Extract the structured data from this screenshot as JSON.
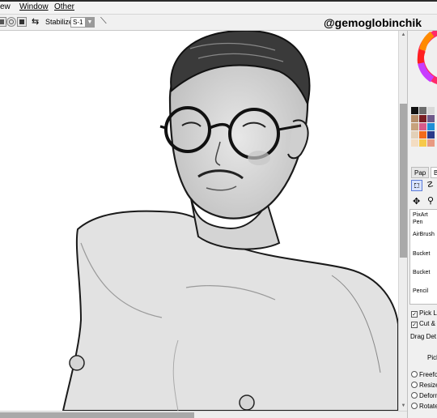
{
  "menu": {
    "items": [
      "ew",
      "Window",
      "Other"
    ]
  },
  "toolbar": {
    "stabilizer_label": "Stabilizer",
    "stabilizer_value": "S-1"
  },
  "watermark": "@gemoglobinchik",
  "palette": {
    "swatches": [
      "#111111",
      "#6c6c6c",
      "#d8d8d8",
      "#b68e6a",
      "#7a1d22",
      "#6f5a8a",
      "#c7a27c",
      "#d65a8a",
      "#1e8fd6",
      "#e2d0b8",
      "#f26a1a",
      "#2a3a8a",
      "#f3dcc2",
      "#f7c94a",
      "#e89a82"
    ]
  },
  "panel": {
    "tabs": [
      "Pap",
      "B"
    ],
    "tools": [
      {
        "line1": "PixArt",
        "line2": "Pen"
      },
      {
        "line1": "AirBrush",
        "line2": ""
      },
      {
        "line1": "Bucket",
        "line2": ""
      },
      {
        "line1": "Bucket",
        "line2": ""
      },
      {
        "line1": "Pencil",
        "line2": ""
      }
    ],
    "checkboxes": [
      {
        "label": "Pick L",
        "checked": true
      },
      {
        "label": "Cut &",
        "checked": true
      }
    ],
    "drag_label": "Drag Det",
    "pick_label": "Pick",
    "radios": [
      "Freefo",
      "Resize",
      "Deform",
      "Rotate"
    ]
  }
}
